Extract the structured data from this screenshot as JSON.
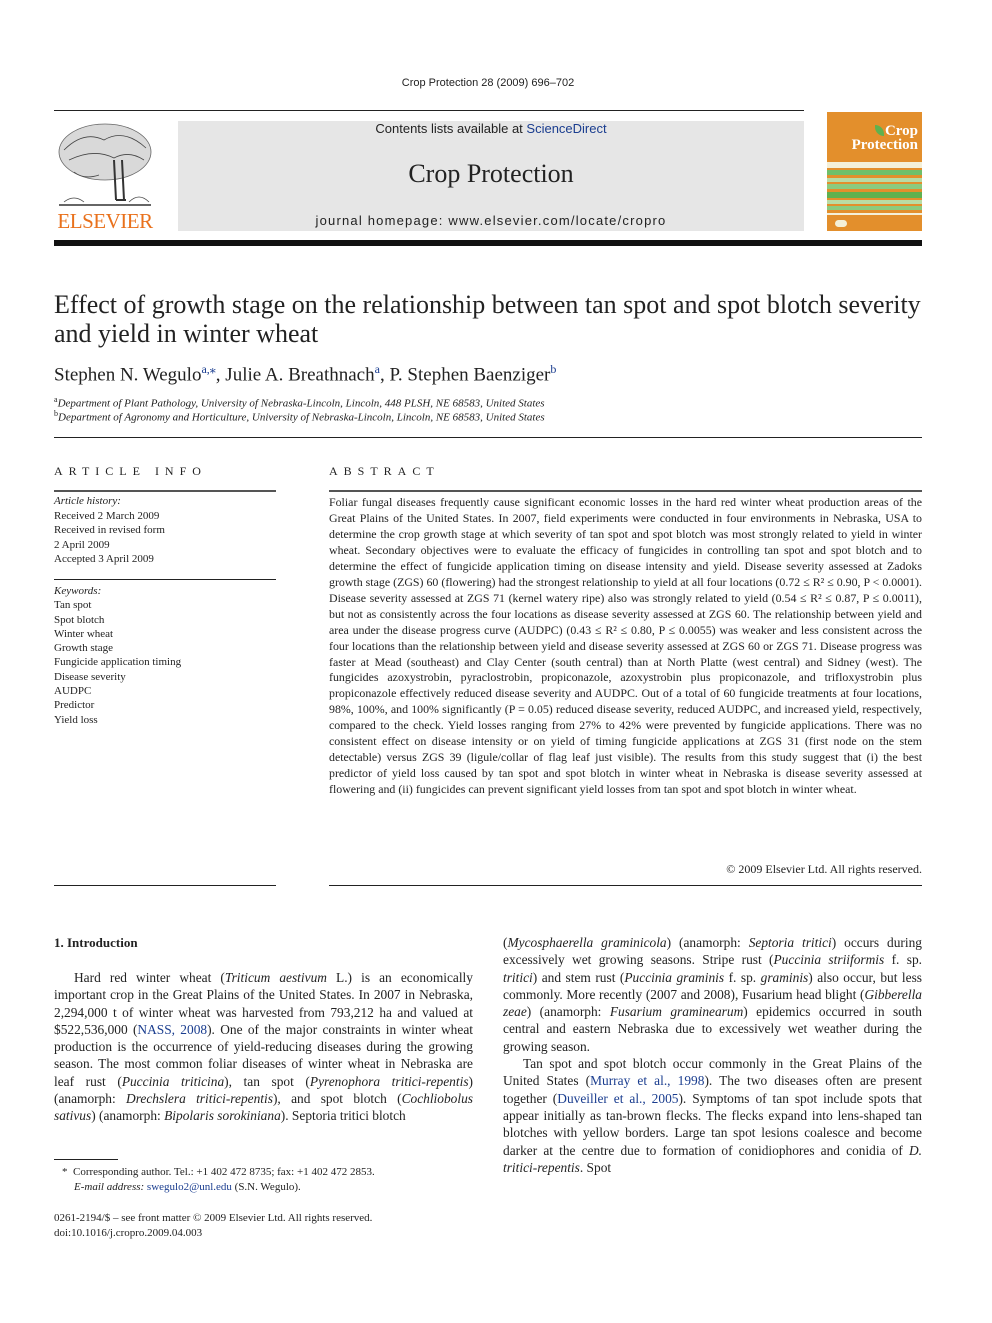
{
  "running_head": "Crop Protection 28 (2009) 696–702",
  "masthead": {
    "contents_prefix": "Contents lists available at ",
    "contents_link": "ScienceDirect",
    "journal_title": "Crop Protection",
    "homepage": "journal homepage: www.elsevier.com/locate/cropro",
    "publisher_logo_text": "ELSEVIER",
    "cover_title_line1": "Crop",
    "cover_title_line2": "Protection",
    "colors": {
      "masthead_bg": "#e6e6e6",
      "elsevier_orange": "#e9711c",
      "cover_orange": "#e38f2c",
      "cover_green": "#6fbf6a",
      "link_blue": "#1a3d8f"
    }
  },
  "article": {
    "title": "Effect of growth stage on the relationship between tan spot and spot blotch severity and yield in winter wheat",
    "authors": [
      {
        "name": "Stephen N. Wegulo",
        "marks": "a,⁎"
      },
      {
        "name": "Julie A. Breathnach",
        "marks": "a"
      },
      {
        "name": "P. Stephen Baenziger",
        "marks": "b"
      }
    ],
    "affiliations": [
      {
        "mark": "a",
        "text": "Department of Plant Pathology, University of Nebraska-Lincoln, Lincoln, 448 PLSH, NE 68583, United States"
      },
      {
        "mark": "b",
        "text": "Department of Agronomy and Horticulture, University of Nebraska-Lincoln, Lincoln, NE 68583, United States"
      }
    ]
  },
  "article_info": {
    "heading": "ARTICLE INFO",
    "history_label": "Article history:",
    "history": [
      "Received 2 March 2009",
      "Received in revised form",
      "2 April 2009",
      "Accepted 3 April 2009"
    ],
    "keywords_label": "Keywords:",
    "keywords": [
      "Tan spot",
      "Spot blotch",
      "Winter wheat",
      "Growth stage",
      "Fungicide application timing",
      "Disease severity",
      "AUDPC",
      "Predictor",
      "Yield loss"
    ]
  },
  "abstract": {
    "heading": "ABSTRACT",
    "text": "Foliar fungal diseases frequently cause significant economic losses in the hard red winter wheat production areas of the Great Plains of the United States. In 2007, field experiments were conducted in four environments in Nebraska, USA to determine the crop growth stage at which severity of tan spot and spot blotch was most strongly related to yield in winter wheat. Secondary objectives were to evaluate the efficacy of fungicides in controlling tan spot and spot blotch and to determine the effect of fungicide application timing on disease intensity and yield. Disease severity assessed at Zadoks growth stage (ZGS) 60 (flowering) had the strongest relationship to yield at all four locations (0.72 ≤ R² ≤ 0.90, P < 0.0001). Disease severity assessed at ZGS 71 (kernel watery ripe) also was strongly related to yield (0.54 ≤ R² ≤ 0.87, P ≤ 0.0011), but not as consistently across the four locations as disease severity assessed at ZGS 60. The relationship between yield and area under the disease progress curve (AUDPC) (0.43 ≤ R² ≤ 0.80, P ≤ 0.0055) was weaker and less consistent across the four locations than the relationship between yield and disease severity assessed at ZGS 60 or ZGS 71. Disease progress was faster at Mead (southeast) and Clay Center (south central) than at North Platte (west central) and Sidney (west). The fungicides azoxystrobin, pyraclostrobin, propiconazole, azoxystrobin plus propiconazole, and trifloxystrobin plus propiconazole effectively reduced disease severity and AUDPC. Out of a total of 60 fungicide treatments at four locations, 98%, 100%, and 100% significantly (P = 0.05) reduced disease severity, reduced AUDPC, and increased yield, respectively, compared to the check. Yield losses ranging from 27% to 42% were prevented by fungicide applications. There was no consistent effect on disease intensity or on yield of timing fungicide applications at ZGS 31 (first node on the stem detectable) versus ZGS 39 (ligule/collar of flag leaf just visible). The results from this study suggest that (i) the best predictor of yield loss caused by tan spot and spot blotch in winter wheat in Nebraska is disease severity assessed at flowering and (ii) fungicides can prevent significant yield losses from tan spot and spot blotch in winter wheat.",
    "copyright": "© 2009 Elsevier Ltd. All rights reserved."
  },
  "introduction": {
    "heading": "1.  Introduction",
    "p1": {
      "a": "Hard red winter wheat (",
      "i1": "Triticum aestivum",
      "b": " L.) is an economically important crop in the Great Plains of the United States. In 2007 in Nebraska, 2,294,000 t of winter wheat was harvested from 793,212 ha and valued at $522,536,000 (",
      "ref1": "NASS, 2008",
      "c": "). One of the major constraints in winter wheat production is the occurrence of yield-reducing diseases during the growing season. The most common foliar diseases of winter wheat in Nebraska are leaf rust (",
      "i2": "Puccinia triticina",
      "d": "), tan spot (",
      "i3": "Pyrenophora tritici-repentis",
      "e": ") (anamorph: ",
      "i4": "Drechslera tritici-repentis",
      "f": "), and spot blotch (",
      "i5": "Cochliobolus sativus",
      "g": ") (anamorph: ",
      "i6": "Bipolaris sorokiniana",
      "h": "). Septoria tritici blotch (",
      "i7": "Mycosphaerella graminicola",
      "i": ") (anamorph: ",
      "i8": "Septoria tritici",
      "j": ") occurs during excessively wet growing seasons. Stripe rust (",
      "i9": "Puccinia striiformis",
      "k": " f. sp. ",
      "i10": "tritici",
      "l": ") and stem rust (",
      "i11": "Puccinia graminis",
      "m": " f. sp. ",
      "i12": "graminis",
      "n": ") also occur, but less commonly. More recently (2007 and 2008), Fusarium head blight (",
      "i13": "Gibberella zeae",
      "o": ") (anamorph: ",
      "i14": "Fusarium graminearum",
      "p": ") epidemics occurred in south central and eastern Nebraska due to excessively wet weather during the growing season."
    },
    "p2": {
      "a": "Tan spot and spot blotch occur commonly in the Great Plains of the United States (",
      "ref1": "Murray et al., 1998",
      "b": "). The two diseases often are present together (",
      "ref2": "Duveiller et al., 2005",
      "c": "). Symptoms of tan spot include spots that appear initially as tan-brown flecks. The flecks expand into lens-shaped tan blotches with yellow borders. Large tan spot lesions coalesce and become darker at the centre due to formation of conidiophores and conidia of ",
      "i1": "D. tritici-repentis",
      "d": ". Spot"
    }
  },
  "footnote": {
    "mark": "*",
    "text": "Corresponding author. Tel.: +1 402 472 8735; fax: +1 402 472 2853.",
    "email_label": "E-mail address:",
    "email": "swegulo2@unl.edu",
    "email_suffix": " (S.N. Wegulo)."
  },
  "front_matter": {
    "issn_line": "0261-2194/$ – see front matter © 2009 Elsevier Ltd. All rights reserved.",
    "doi": "doi:10.1016/j.cropro.2009.04.003"
  }
}
